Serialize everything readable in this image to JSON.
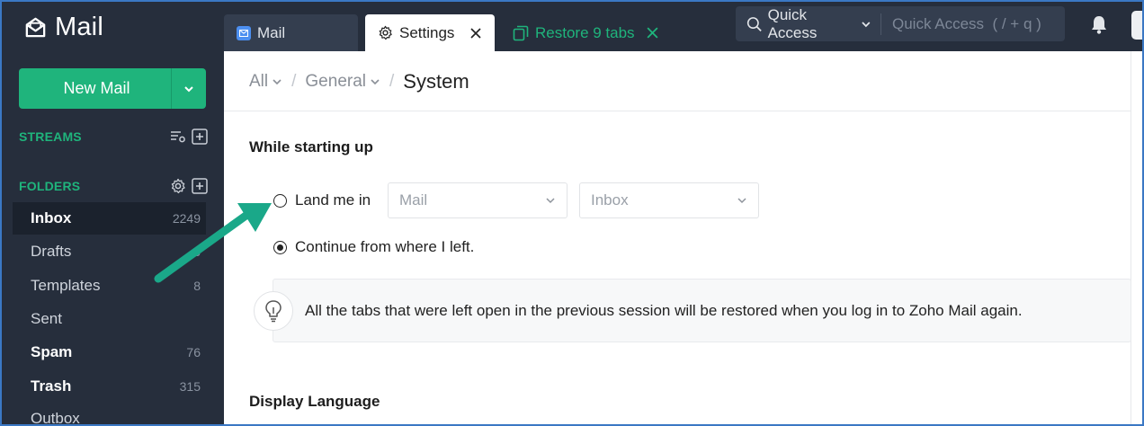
{
  "app": {
    "name": "Mail"
  },
  "sidebar": {
    "new_mail_label": "New Mail",
    "streams_label": "STREAMS",
    "folders_label": "FOLDERS",
    "folders": [
      {
        "name": "Inbox",
        "count": "2249"
      },
      {
        "name": "Drafts",
        "count": "6"
      },
      {
        "name": "Templates",
        "count": "8"
      },
      {
        "name": "Sent",
        "count": ""
      },
      {
        "name": "Spam",
        "count": "76"
      },
      {
        "name": "Trash",
        "count": "315"
      },
      {
        "name": "Outbox",
        "count": ""
      }
    ]
  },
  "tabs": {
    "mail_label": "Mail",
    "settings_label": "Settings",
    "restore_label": "Restore 9 tabs"
  },
  "quick_access": {
    "label": "Quick Access",
    "placeholder": "Quick Access  ( / + q )"
  },
  "breadcrumb": {
    "all": "All",
    "general": "General",
    "current": "System",
    "separator": "/"
  },
  "startup": {
    "title": "While starting up",
    "land_label": "Land me in",
    "land_checked": false,
    "app_select": "Mail",
    "folder_select": "Inbox",
    "continue_label": "Continue from where I left.",
    "continue_checked": true,
    "info_text": "All the tabs that were left open in the previous session will be restored when you log in to Zoho Mail again."
  },
  "language": {
    "title": "Display Language"
  },
  "colors": {
    "accent": "#1fb47c",
    "sidebar_bg": "#262e3c",
    "annotation_arrow": "#1aa889"
  }
}
